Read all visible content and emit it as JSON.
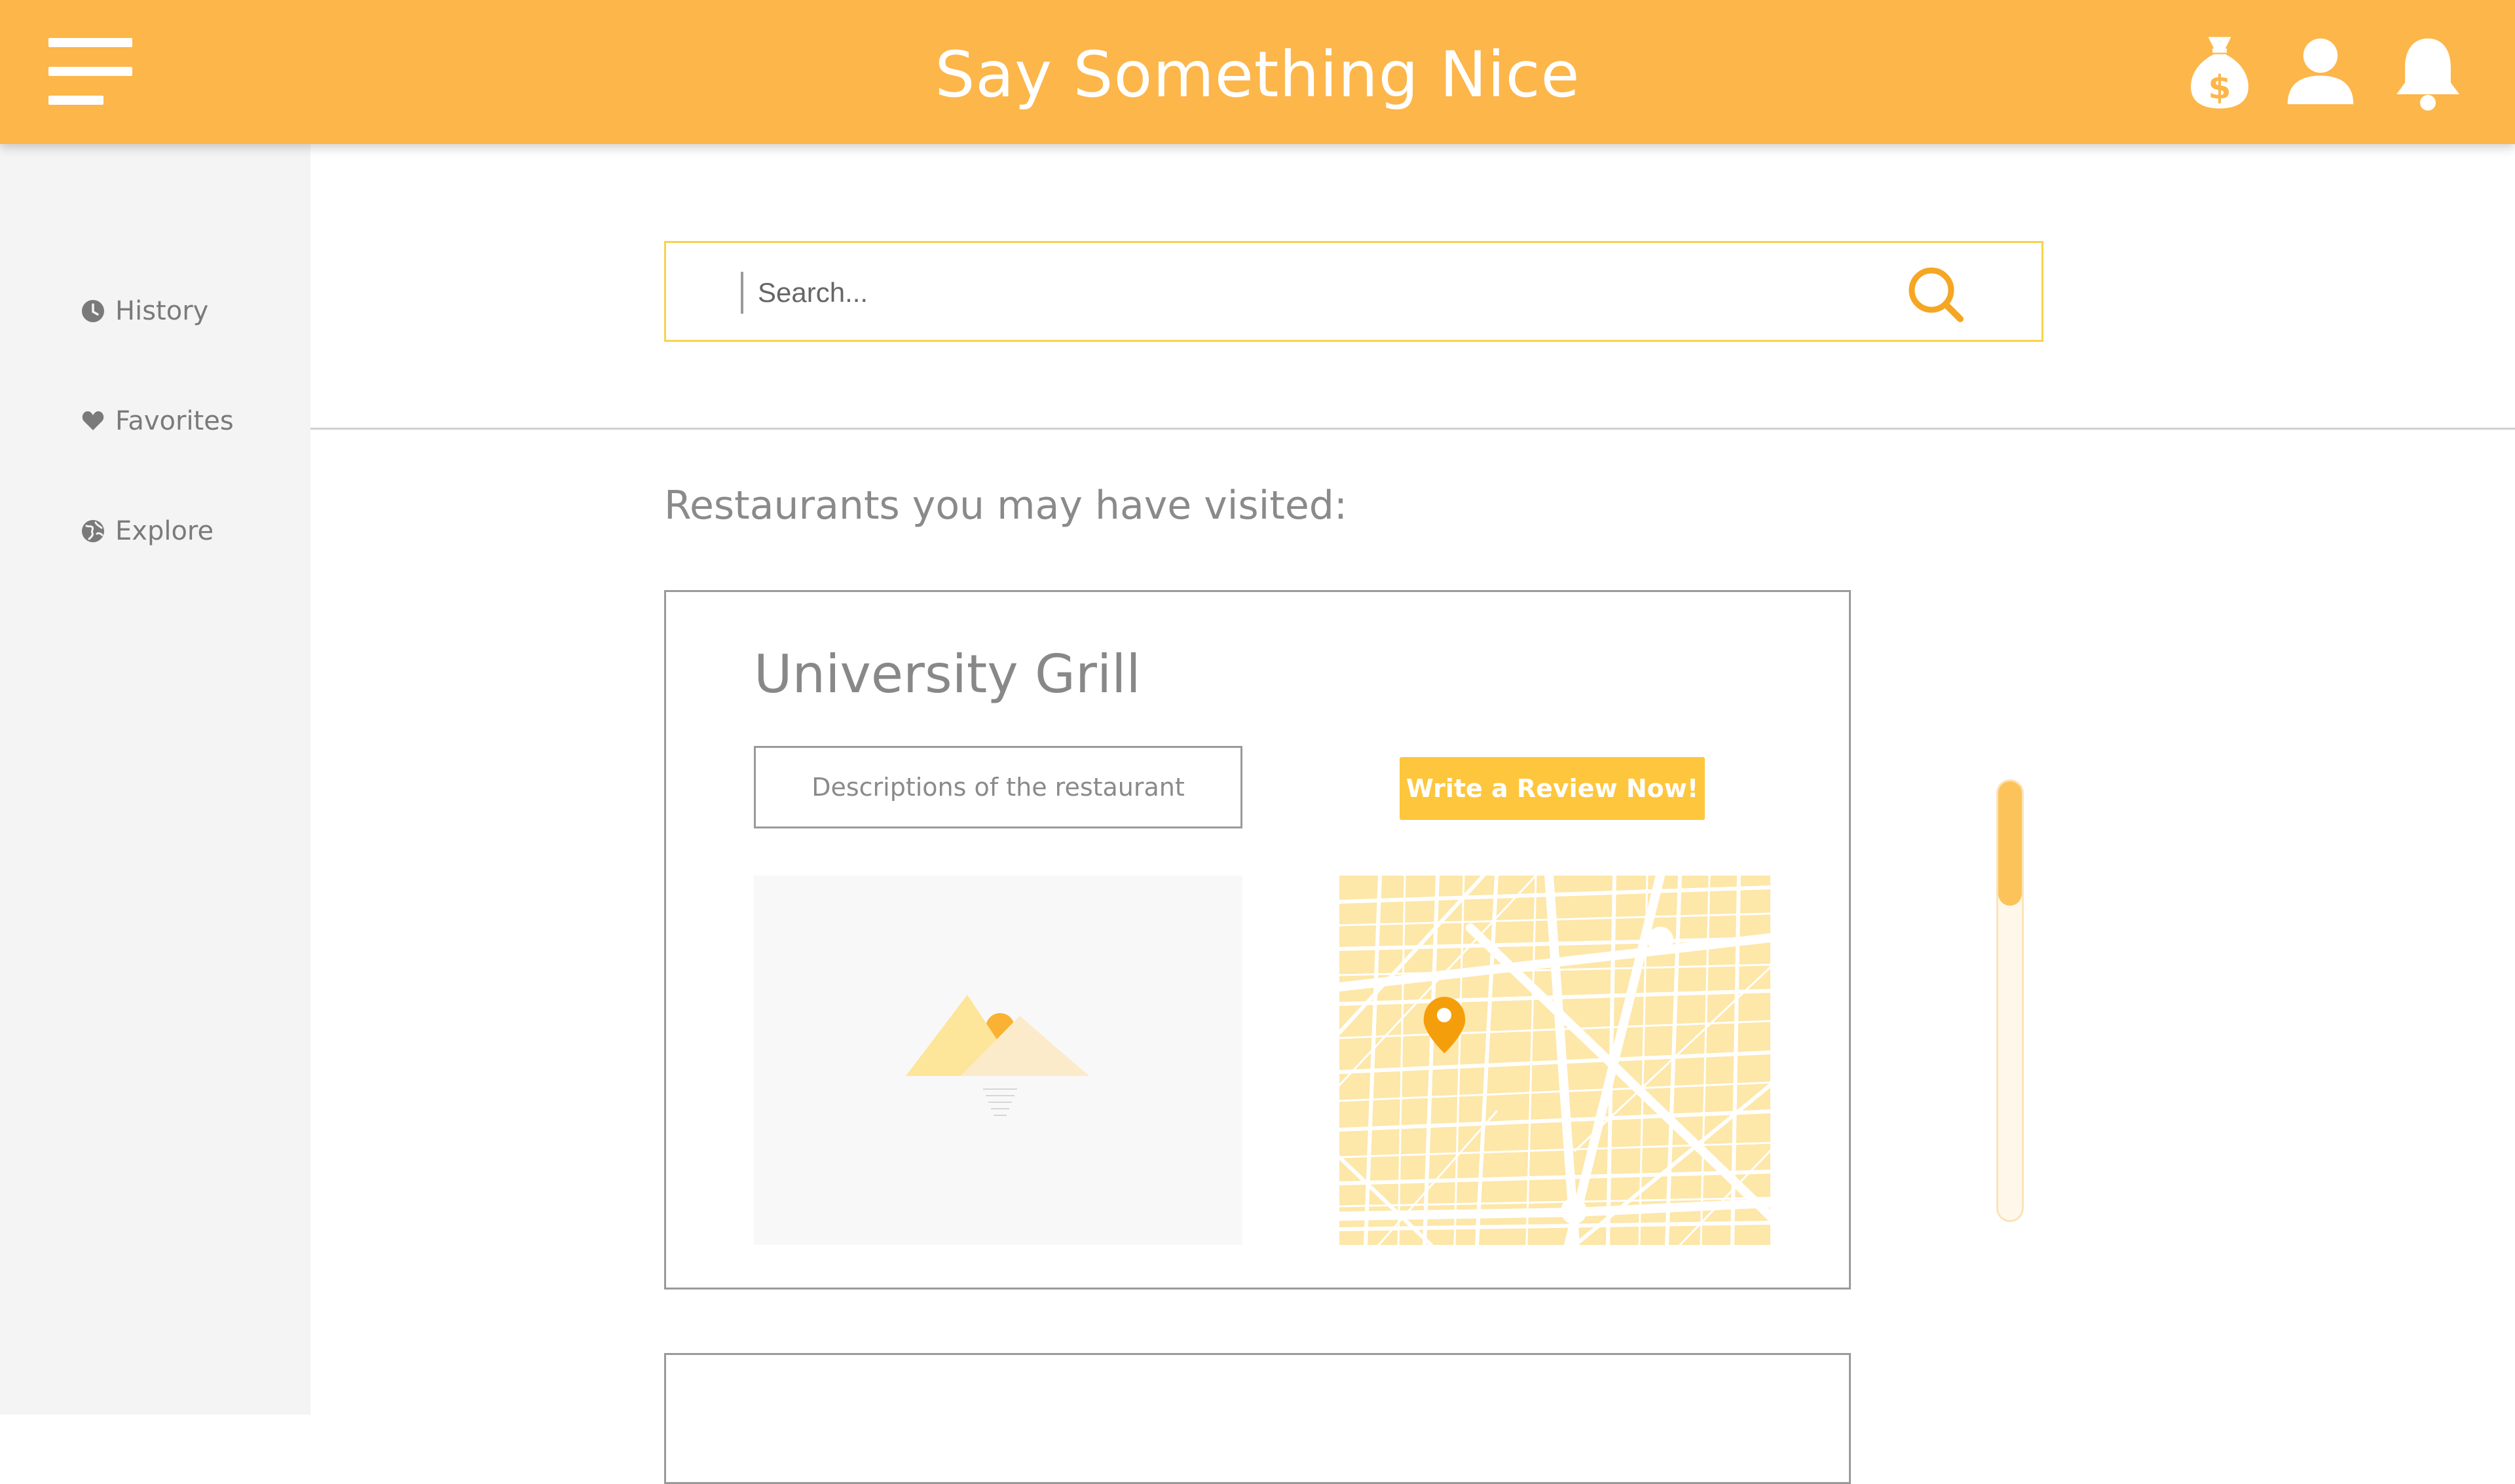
{
  "app": {
    "title": "Say Something Nice",
    "header_color": "#FDB64A"
  },
  "header_icons": [
    "menu-icon",
    "money-bag-icon",
    "user-icon",
    "bell-icon"
  ],
  "sidebar": {
    "items": [
      {
        "label": "History",
        "icon": "clock-icon"
      },
      {
        "label": "Favorites",
        "icon": "heart-icon"
      },
      {
        "label": "Explore",
        "icon": "globe-icon"
      }
    ]
  },
  "search": {
    "placeholder": "Search...",
    "value": ""
  },
  "main": {
    "section_title": "Restaurants you may have visited:",
    "restaurants": [
      {
        "name": "University Grill",
        "description": "Descriptions of the restaurant",
        "review_button": "Write a Review Now!"
      }
    ]
  },
  "colors": {
    "accent": "#FDB64A",
    "button": "#FDC63D",
    "search_border": "#F8D24E",
    "map_pin": "#F59E0B"
  }
}
